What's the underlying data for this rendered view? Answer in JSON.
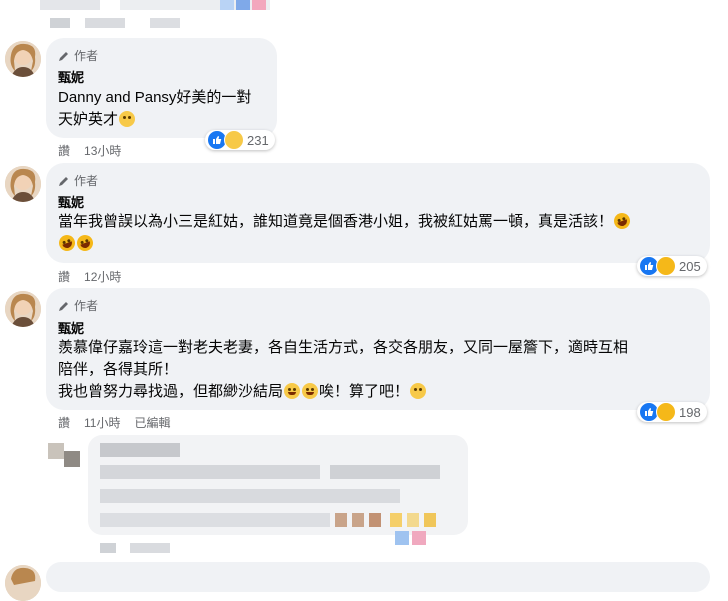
{
  "comments": [
    {
      "author_badge": "作者",
      "name": "甄妮",
      "lines": [
        "Danny and Pansy好美的一對",
        "天妒英才"
      ],
      "actions": [
        "讚",
        "13小時"
      ],
      "reaction_count": "231",
      "reaction_icons": [
        "like-icon",
        "sad-icon"
      ]
    },
    {
      "author_badge": "作者",
      "name": "甄妮",
      "lines": [
        "當年我曾誤以為小三是紅姑，誰知道竟是個香港小姐，我被紅姑罵一頓，真是活該！"
      ],
      "actions": [
        "讚",
        "12小時"
      ],
      "reaction_count": "205",
      "reaction_icons": [
        "like-icon",
        "haha-icon"
      ]
    },
    {
      "author_badge": "作者",
      "name": "甄妮",
      "lines": [
        "羨慕偉仔嘉玲這一對老夫老妻，各自生活方式，各交各朋友，又同一屋簷下，適時互相",
        "陪伴，各得其所！",
        "我也曾努力尋找過，但都緲沙結局",
        "唉！算了吧！"
      ],
      "actions": [
        "讚",
        "11小時",
        "已編輯"
      ],
      "reaction_count": "198",
      "reaction_icons": [
        "like-icon",
        "haha-icon"
      ]
    }
  ],
  "colors": {
    "bubble": "#f0f2f5",
    "meta": "#65676b",
    "like": "#1877f2",
    "emoji": "#f7c948"
  }
}
